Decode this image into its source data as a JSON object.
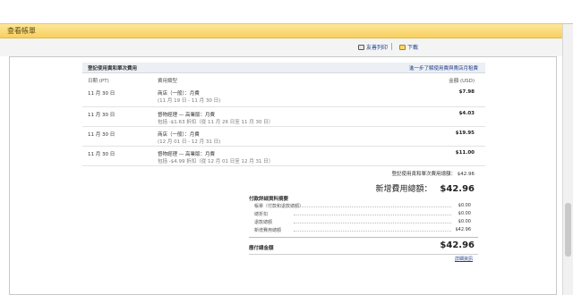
{
  "window": {
    "title": "查看帳單"
  },
  "actions": {
    "print_label": "友善列印",
    "download_label": "下載"
  },
  "sheet": {
    "header_title": "登記使用責和單次費用",
    "header_link": "進一步了解使用費與賣店月租費",
    "columns": {
      "date": "日期 (PT)",
      "type": "費用類型",
      "amount": "金額 (USD)"
    },
    "rows": [
      {
        "date": "11 月 30 日",
        "type": "商店（一般）：月費",
        "sub": "(11 月 19 日 - 11 月 30 日)",
        "amount": "$7.98"
      },
      {
        "date": "11 月 30 日",
        "type": "督物經理 — 高業版：月費",
        "sub": "包括 -$1.63 折扣（從 11 月 26 日至 11 月 30 日）",
        "amount": "$4.03"
      },
      {
        "date": "11 月 30 日",
        "type": "商店（一般）：月費",
        "sub": "(12 月 01 日 - 12 月 31 日)",
        "amount": "$19.95"
      },
      {
        "date": "11 月 30 日",
        "type": "督物經理 — 高業版：月費",
        "sub": "包括 -$4.99 折扣（從 12 月 01 日至 12 月 31 日）",
        "amount": "$11.00"
      }
    ],
    "period_total_label": "登記使用責和單次費用總額：",
    "period_total_value": "$42.96",
    "new_total_label": "新增費用總額：",
    "new_total_value": "$42.96"
  },
  "summary": {
    "title": "付款詳細資料摘要",
    "lines": [
      {
        "label": "帳單（付款和退款總額）",
        "value": "$0.00"
      },
      {
        "label": "總折扣",
        "value": "$0.00"
      },
      {
        "label": "退款總額",
        "value": "$0.00"
      },
      {
        "label": "新增費用總額",
        "value": "$42.96"
      }
    ],
    "pay_label": "應付總金額",
    "pay_value": "$42.96",
    "more_link": "詳細資訊"
  }
}
